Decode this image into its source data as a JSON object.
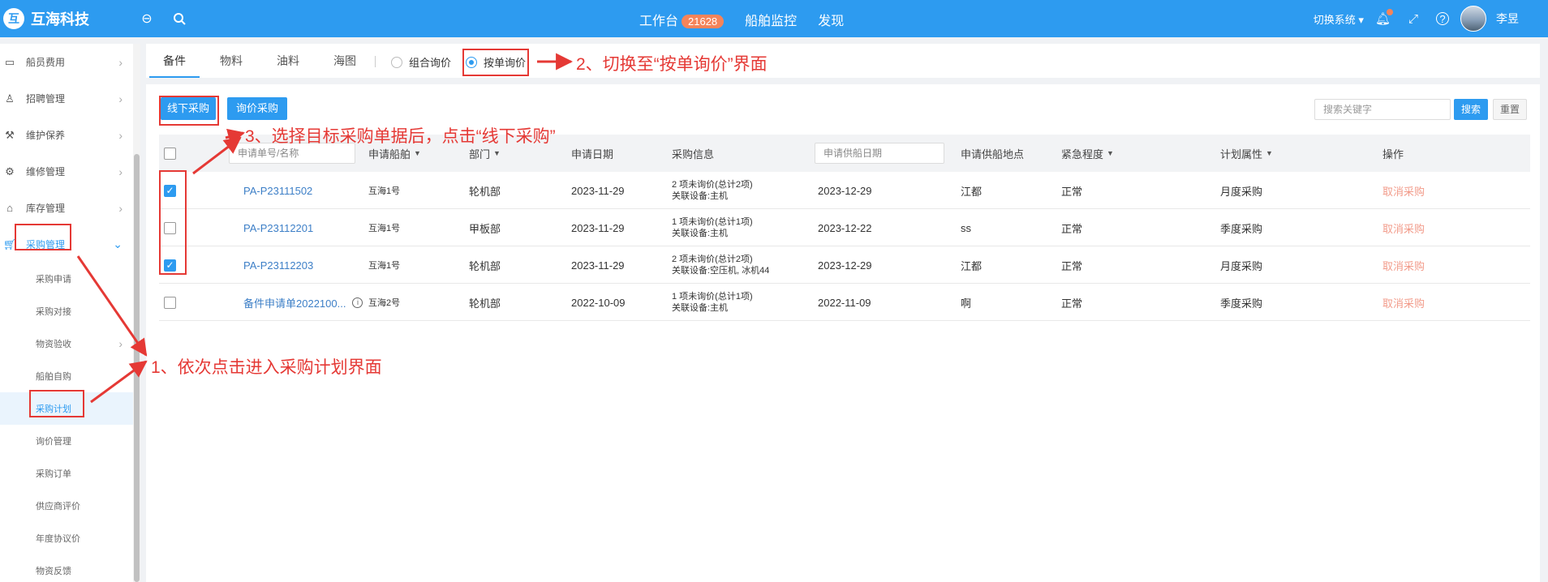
{
  "app": {
    "brand": "互海科技",
    "logo_glyph": "互"
  },
  "topbar": {
    "nav": {
      "workbench": "工作台",
      "workbench_badge": "21628",
      "ship_monitor": "船舶监控",
      "discover": "发现"
    },
    "switch_system": "切换系统",
    "username": "李昱"
  },
  "sidebar": {
    "items": [
      {
        "label": "船员费用",
        "icon": "wallet-icon"
      },
      {
        "label": "招聘管理",
        "icon": "user-icon"
      },
      {
        "label": "维护保养",
        "icon": "tool-icon"
      },
      {
        "label": "维修管理",
        "icon": "wrench-icon"
      },
      {
        "label": "库存管理",
        "icon": "home-icon"
      },
      {
        "label": "采购管理",
        "icon": "cart-icon"
      }
    ],
    "sub_items": [
      "采购申请",
      "采购对接",
      "物资验收",
      "船舶自购",
      "采购计划",
      "询价管理",
      "采购订单",
      "供应商评价",
      "年度协议价",
      "物资反馈"
    ]
  },
  "tabs": [
    "备件",
    "物料",
    "油料",
    "海图"
  ],
  "radio_options": {
    "combined": "组合询价",
    "by_order": "按单询价"
  },
  "toolbar": {
    "offline_purchase": "线下采购",
    "inquiry_purchase": "询价采购",
    "search_placeholder": "搜索关键字",
    "search_btn": "搜索",
    "reset_btn": "重置"
  },
  "table": {
    "headers": {
      "order_no_placeholder": "申请单号/名称",
      "ship": "申请船舶",
      "dept": "部门",
      "apply_date": "申请日期",
      "purchase_info": "采购信息",
      "supply_date_placeholder": "申请供船日期",
      "supply_place": "申请供船地点",
      "urgency": "紧急程度",
      "plan_attr": "计划属性",
      "operation": "操作"
    },
    "rows": [
      {
        "checked": true,
        "no": "PA-P23111502",
        "ship": "互海1号",
        "dept": "轮机部",
        "date": "2023-11-29",
        "info1": "2 项未询价(总计2项)",
        "info2": "关联设备:主机",
        "supply_date": "2023-12-29",
        "place": "江都",
        "urgency": "正常",
        "plan": "月度采购",
        "op": "取消采购"
      },
      {
        "checked": false,
        "no": "PA-P23112201",
        "ship": "互海1号",
        "dept": "甲板部",
        "date": "2023-11-29",
        "info1": "1 项未询价(总计1项)",
        "info2": "关联设备:主机",
        "supply_date": "2023-12-22",
        "place": "ss",
        "urgency": "正常",
        "plan": "季度采购",
        "op": "取消采购"
      },
      {
        "checked": true,
        "no": "PA-P23112203",
        "ship": "互海1号",
        "dept": "轮机部",
        "date": "2023-11-29",
        "info1": "2 项未询价(总计2项)",
        "info2": "关联设备:空压机, 冰机44",
        "supply_date": "2023-12-29",
        "place": "江都",
        "urgency": "正常",
        "plan": "月度采购",
        "op": "取消采购"
      },
      {
        "checked": false,
        "no": "备件申请单2022100...",
        "ship": "互海2号",
        "dept": "轮机部",
        "date": "2022-10-09",
        "info1": "1 项未询价(总计1项)",
        "info2": "关联设备:主机",
        "supply_date": "2022-11-09",
        "place": "啊",
        "urgency": "正常",
        "plan": "季度采购",
        "op": "取消采购"
      }
    ]
  },
  "annotations": {
    "step1": "1、依次点击进入采购计划界面",
    "step2": "2、切换至“按单询价”界面",
    "step3": "3、选择目标采购单据后，点击“线下采购”"
  },
  "colors": {
    "primary": "#2d9bf0",
    "annotation": "#e53935",
    "cancel_link": "#f29b8a"
  }
}
